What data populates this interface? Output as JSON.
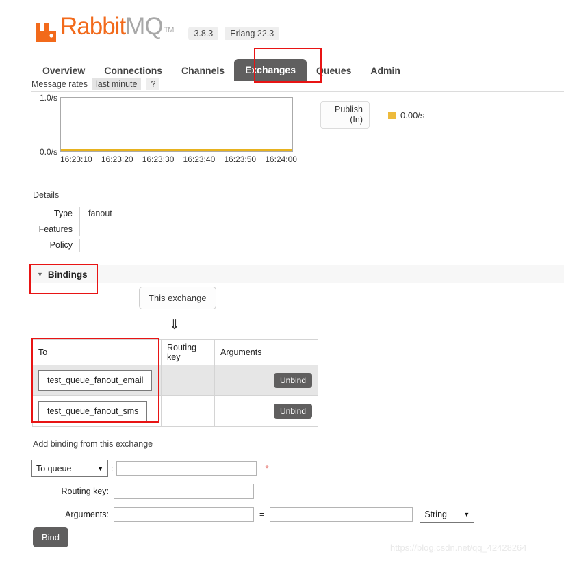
{
  "brand": {
    "name_primary": "Rabbit",
    "name_secondary": "MQ",
    "trademark": "TM",
    "logo_icon": "rabbitmq-logo-icon",
    "accent_color": "#f26a1b",
    "version_badge": "3.8.3",
    "erlang_badge": "Erlang 22.3"
  },
  "nav": {
    "tabs": [
      {
        "label": "Overview",
        "active": false
      },
      {
        "label": "Connections",
        "active": false
      },
      {
        "label": "Channels",
        "active": false
      },
      {
        "label": "Exchanges",
        "active": true
      },
      {
        "label": "Queues",
        "active": false
      },
      {
        "label": "Admin",
        "active": false
      }
    ]
  },
  "rates": {
    "label": "Message rates",
    "period": "last minute",
    "help": "?"
  },
  "chart_data": {
    "type": "line",
    "title": "Message rates",
    "xlabel": "",
    "ylabel": "",
    "ylim": [
      0.0,
      1.0
    ],
    "y_ticks": [
      "0.0/s",
      "1.0/s"
    ],
    "x_ticks": [
      "16:23:10",
      "16:23:20",
      "16:23:30",
      "16:23:40",
      "16:23:50",
      "16:24:00"
    ],
    "grid": false,
    "legend_position": "right",
    "series": [
      {
        "name": "Publish (In)",
        "color": "#edba3c",
        "current_value": "0.00/s",
        "values": [
          0,
          0,
          0,
          0,
          0,
          0
        ]
      }
    ]
  },
  "legend": {
    "key_line1": "Publish",
    "key_line2": "(In)",
    "value": "0.00/s"
  },
  "details": {
    "heading": "Details",
    "rows": [
      {
        "key": "Type",
        "value": "fanout"
      },
      {
        "key": "Features",
        "value": ""
      },
      {
        "key": "Policy",
        "value": ""
      }
    ]
  },
  "bindings": {
    "heading": "Bindings",
    "collapse_icon": "▼",
    "source_box": "This exchange",
    "flow_arrow": "⇓",
    "columns": [
      "To",
      "Routing key",
      "Arguments",
      ""
    ],
    "rows": [
      {
        "to": "test_queue_fanout_email",
        "routing_key": "",
        "arguments": "",
        "action": "Unbind"
      },
      {
        "to": "test_queue_fanout_sms",
        "routing_key": "",
        "arguments": "",
        "action": "Unbind"
      }
    ]
  },
  "add_binding": {
    "heading": "Add binding from this exchange",
    "destination_select": "To queue",
    "destination_value": "",
    "destination_placeholder": "",
    "required_marker": "*",
    "routing_key_label": "Routing key:",
    "routing_key_value": "",
    "arguments_label": "Arguments:",
    "arguments_key_value": "",
    "equals_sign": "=",
    "arguments_value": "",
    "type_select": "String",
    "submit_label": "Bind",
    "colon": ":"
  },
  "watermark": "https://blog.csdn.net/qq_42428264"
}
